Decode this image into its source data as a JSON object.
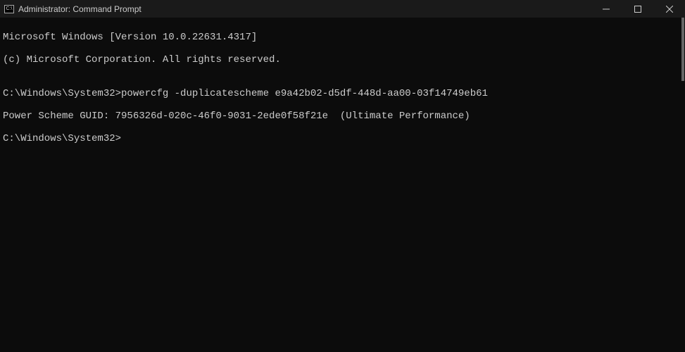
{
  "titlebar": {
    "title": "Administrator: Command Prompt"
  },
  "terminal": {
    "line1": "Microsoft Windows [Version 10.0.22631.4317]",
    "line2": "(c) Microsoft Corporation. All rights reserved.",
    "blank1": "",
    "prompt1_path": "C:\\Windows\\System32>",
    "prompt1_cmd": "powercfg -duplicatescheme e9a42b02-d5df-448d-aa00-03f14749eb61",
    "output1": "Power Scheme GUID: 7956326d-020c-46f0-9031-2ede0f58f21e  (Ultimate Performance)",
    "prompt2_path": "C:\\Windows\\System32>"
  }
}
